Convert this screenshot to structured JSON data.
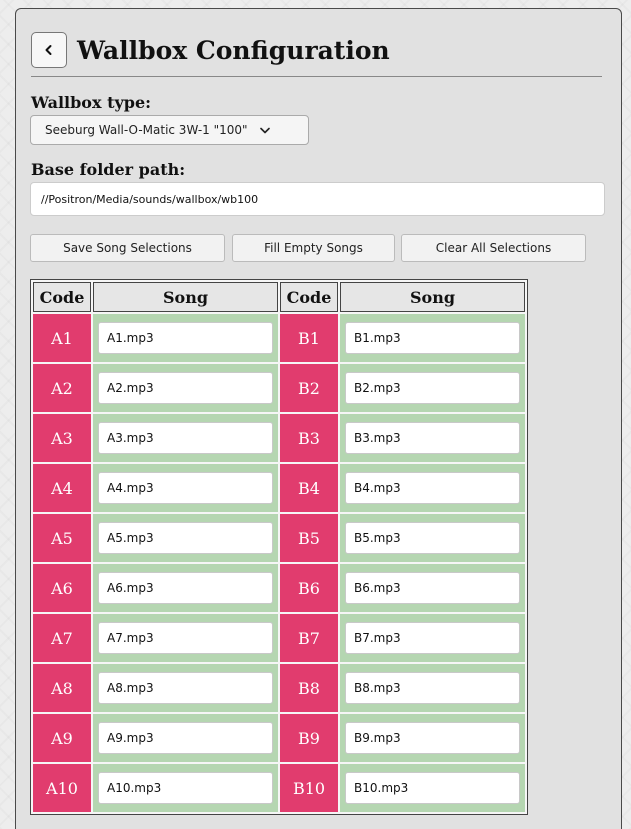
{
  "page_title": "Wallbox Configuration",
  "wallbox_type": {
    "label": "Wallbox type:",
    "selected": "Seeburg Wall-O-Matic 3W-1 \"100\""
  },
  "base_folder": {
    "label": "Base folder path:",
    "value": "//Positron/Media/sounds/wallbox/wb100"
  },
  "buttons": {
    "save": "Save Song Selections",
    "fill": "Fill Empty Songs",
    "clear": "Clear All Selections"
  },
  "table": {
    "headers": [
      "Code",
      "Song",
      "Code",
      "Song"
    ],
    "rows": [
      {
        "a_code": "A1",
        "a_song": "A1.mp3",
        "b_code": "B1",
        "b_song": "B1.mp3"
      },
      {
        "a_code": "A2",
        "a_song": "A2.mp3",
        "b_code": "B2",
        "b_song": "B2.mp3"
      },
      {
        "a_code": "A3",
        "a_song": "A3.mp3",
        "b_code": "B3",
        "b_song": "B3.mp3"
      },
      {
        "a_code": "A4",
        "a_song": "A4.mp3",
        "b_code": "B4",
        "b_song": "B4.mp3"
      },
      {
        "a_code": "A5",
        "a_song": "A5.mp3",
        "b_code": "B5",
        "b_song": "B5.mp3"
      },
      {
        "a_code": "A6",
        "a_song": "A6.mp3",
        "b_code": "B6",
        "b_song": "B6.mp3"
      },
      {
        "a_code": "A7",
        "a_song": "A7.mp3",
        "b_code": "B7",
        "b_song": "B7.mp3"
      },
      {
        "a_code": "A8",
        "a_song": "A8.mp3",
        "b_code": "B8",
        "b_song": "B8.mp3"
      },
      {
        "a_code": "A9",
        "a_song": "A9.mp3",
        "b_code": "B9",
        "b_song": "B9.mp3"
      },
      {
        "a_code": "A10",
        "a_song": "A10.mp3",
        "b_code": "B10",
        "b_song": "B10.mp3"
      }
    ]
  },
  "icons": {
    "back": "chevron-left-icon",
    "dropdown": "chevron-down-icon"
  },
  "colors": {
    "code_cell": "#e13c6e",
    "song_cell": "#b5d6b1"
  }
}
